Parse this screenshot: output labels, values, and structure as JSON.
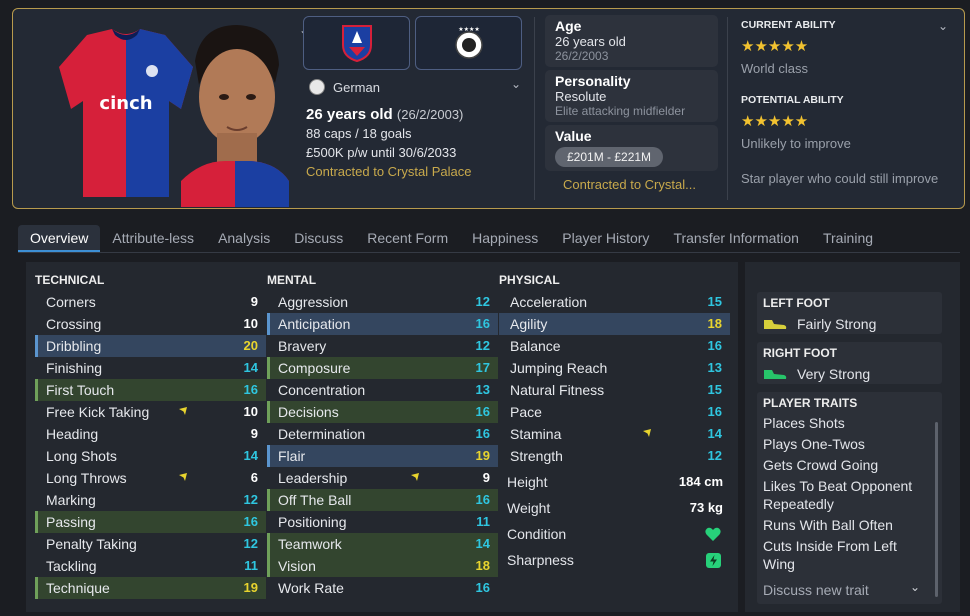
{
  "header": {
    "nationality": "German",
    "age_line": "26 years old",
    "dob_paren": "(26/2/2003)",
    "caps": "88 caps / 18 goals",
    "wage": "£500K p/w until 30/6/2033",
    "contract": "Contracted to Crystal Palace"
  },
  "mid": {
    "age_label": "Age",
    "age_value": "26 years old",
    "dob": "26/2/2003",
    "personality_label": "Personality",
    "personality_value": "Resolute",
    "role": "Elite attacking midfielder",
    "value_label": "Value",
    "value_range": "£201M - £221M",
    "contract_short": "Contracted to Crystal..."
  },
  "ability": {
    "current_title": "CURRENT ABILITY",
    "current_stars": 5,
    "current_desc": "World class",
    "potential_title": "POTENTIAL ABILITY",
    "potential_stars": 5,
    "potential_desc": "Unlikely to improve",
    "summary": "Star player who could still improve"
  },
  "tabs": [
    "Overview",
    "Attribute-less",
    "Analysis",
    "Discuss",
    "Recent Form",
    "Happiness",
    "Player History",
    "Transfer Information",
    "Training"
  ],
  "columns": {
    "technical": "TECHNICAL",
    "mental": "MENTAL",
    "physical": "PHYSICAL"
  },
  "technical": [
    {
      "name": "Corners",
      "value": "9",
      "hl": ""
    },
    {
      "name": "Crossing",
      "value": "10",
      "hl": ""
    },
    {
      "name": "Dribbling",
      "value": "20",
      "hl": "b"
    },
    {
      "name": "Finishing",
      "value": "14",
      "hl": ""
    },
    {
      "name": "First Touch",
      "value": "16",
      "hl": "g"
    },
    {
      "name": "Free Kick Taking",
      "value": "10",
      "hl": "",
      "arrow": true
    },
    {
      "name": "Heading",
      "value": "9",
      "hl": ""
    },
    {
      "name": "Long Shots",
      "value": "14",
      "hl": ""
    },
    {
      "name": "Long Throws",
      "value": "6",
      "hl": "",
      "arrow": true
    },
    {
      "name": "Marking",
      "value": "12",
      "hl": ""
    },
    {
      "name": "Passing",
      "value": "16",
      "hl": "g"
    },
    {
      "name": "Penalty Taking",
      "value": "12",
      "hl": ""
    },
    {
      "name": "Tackling",
      "value": "11",
      "hl": ""
    },
    {
      "name": "Technique",
      "value": "19",
      "hl": "g"
    }
  ],
  "mental": [
    {
      "name": "Aggression",
      "value": "12",
      "hl": ""
    },
    {
      "name": "Anticipation",
      "value": "16",
      "hl": "b"
    },
    {
      "name": "Bravery",
      "value": "12",
      "hl": ""
    },
    {
      "name": "Composure",
      "value": "17",
      "hl": "g"
    },
    {
      "name": "Concentration",
      "value": "13",
      "hl": ""
    },
    {
      "name": "Decisions",
      "value": "16",
      "hl": "g"
    },
    {
      "name": "Determination",
      "value": "16",
      "hl": ""
    },
    {
      "name": "Flair",
      "value": "19",
      "hl": "b"
    },
    {
      "name": "Leadership",
      "value": "9",
      "hl": "",
      "arrow": true
    },
    {
      "name": "Off The Ball",
      "value": "16",
      "hl": "g"
    },
    {
      "name": "Positioning",
      "value": "11",
      "hl": ""
    },
    {
      "name": "Teamwork",
      "value": "14",
      "hl": "g"
    },
    {
      "name": "Vision",
      "value": "18",
      "hl": "g"
    },
    {
      "name": "Work Rate",
      "value": "16",
      "hl": ""
    }
  ],
  "physical": [
    {
      "name": "Acceleration",
      "value": "15",
      "hl": ""
    },
    {
      "name": "Agility",
      "value": "18",
      "hl": "p"
    },
    {
      "name": "Balance",
      "value": "16",
      "hl": ""
    },
    {
      "name": "Jumping Reach",
      "value": "13",
      "hl": ""
    },
    {
      "name": "Natural Fitness",
      "value": "15",
      "hl": ""
    },
    {
      "name": "Pace",
      "value": "16",
      "hl": ""
    },
    {
      "name": "Stamina",
      "value": "14",
      "hl": "",
      "arrow": true
    },
    {
      "name": "Strength",
      "value": "12",
      "hl": ""
    }
  ],
  "extra": {
    "height_label": "Height",
    "height_value": "184 cm",
    "weight_label": "Weight",
    "weight_value": "73 kg",
    "condition_label": "Condition",
    "sharpness_label": "Sharpness"
  },
  "side": {
    "left_foot_title": "LEFT FOOT",
    "left_foot_value": "Fairly Strong",
    "right_foot_title": "RIGHT FOOT",
    "right_foot_value": "Very Strong",
    "traits_title": "PLAYER TRAITS",
    "traits": [
      "Places Shots",
      "Plays One-Twos",
      "Gets Crowd Going",
      "Likes To Beat Opponent Repeatedly",
      "Runs With Ball Often",
      "Cuts Inside From Left Wing"
    ],
    "discuss": "Discuss new trait"
  },
  "colors": {
    "accent": "#3d8fd4",
    "gold": "#c8a94c",
    "cyan": "#2fc6e0",
    "yellow": "#e8d42e",
    "border": "#b79a4d"
  }
}
